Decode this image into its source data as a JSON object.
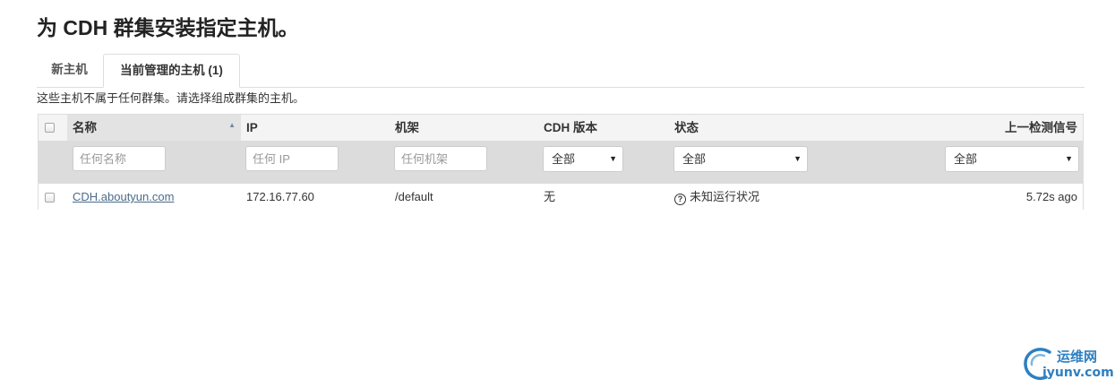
{
  "page": {
    "title": "为 CDH 群集安装指定主机。"
  },
  "tabs": {
    "new_hosts": "新主机",
    "current_hosts": "当前管理的主机 (1)"
  },
  "info_text": "这些主机不属于任何群集。请选择组成群集的主机。",
  "table": {
    "columns": {
      "name": "名称",
      "ip": "IP",
      "rack": "机架",
      "cdh_version": "CDH 版本",
      "status": "状态",
      "last_heartbeat": "上一检测信号"
    },
    "filters": {
      "name_placeholder": "任何名称",
      "ip_placeholder": "任何 IP",
      "rack_placeholder": "任何机架",
      "cdh_version_selected": "全部",
      "status_selected": "全部",
      "heartbeat_selected": "全部"
    },
    "rows": [
      {
        "name": "CDH.aboutyun.com",
        "ip": "172.16.77.60",
        "rack": "/default",
        "cdh_version": "无",
        "status": "未知运行状况",
        "status_icon": "question-circle-icon",
        "last_heartbeat": "5.72s ago"
      }
    ]
  },
  "watermark": {
    "cn": "运维网",
    "en": "iyunv.com"
  },
  "colors": {
    "link": "#4a6b8a",
    "header_bg": "#f4f4f4",
    "filter_bg": "#dcdcdc",
    "watermark": "#2d7fc1"
  }
}
